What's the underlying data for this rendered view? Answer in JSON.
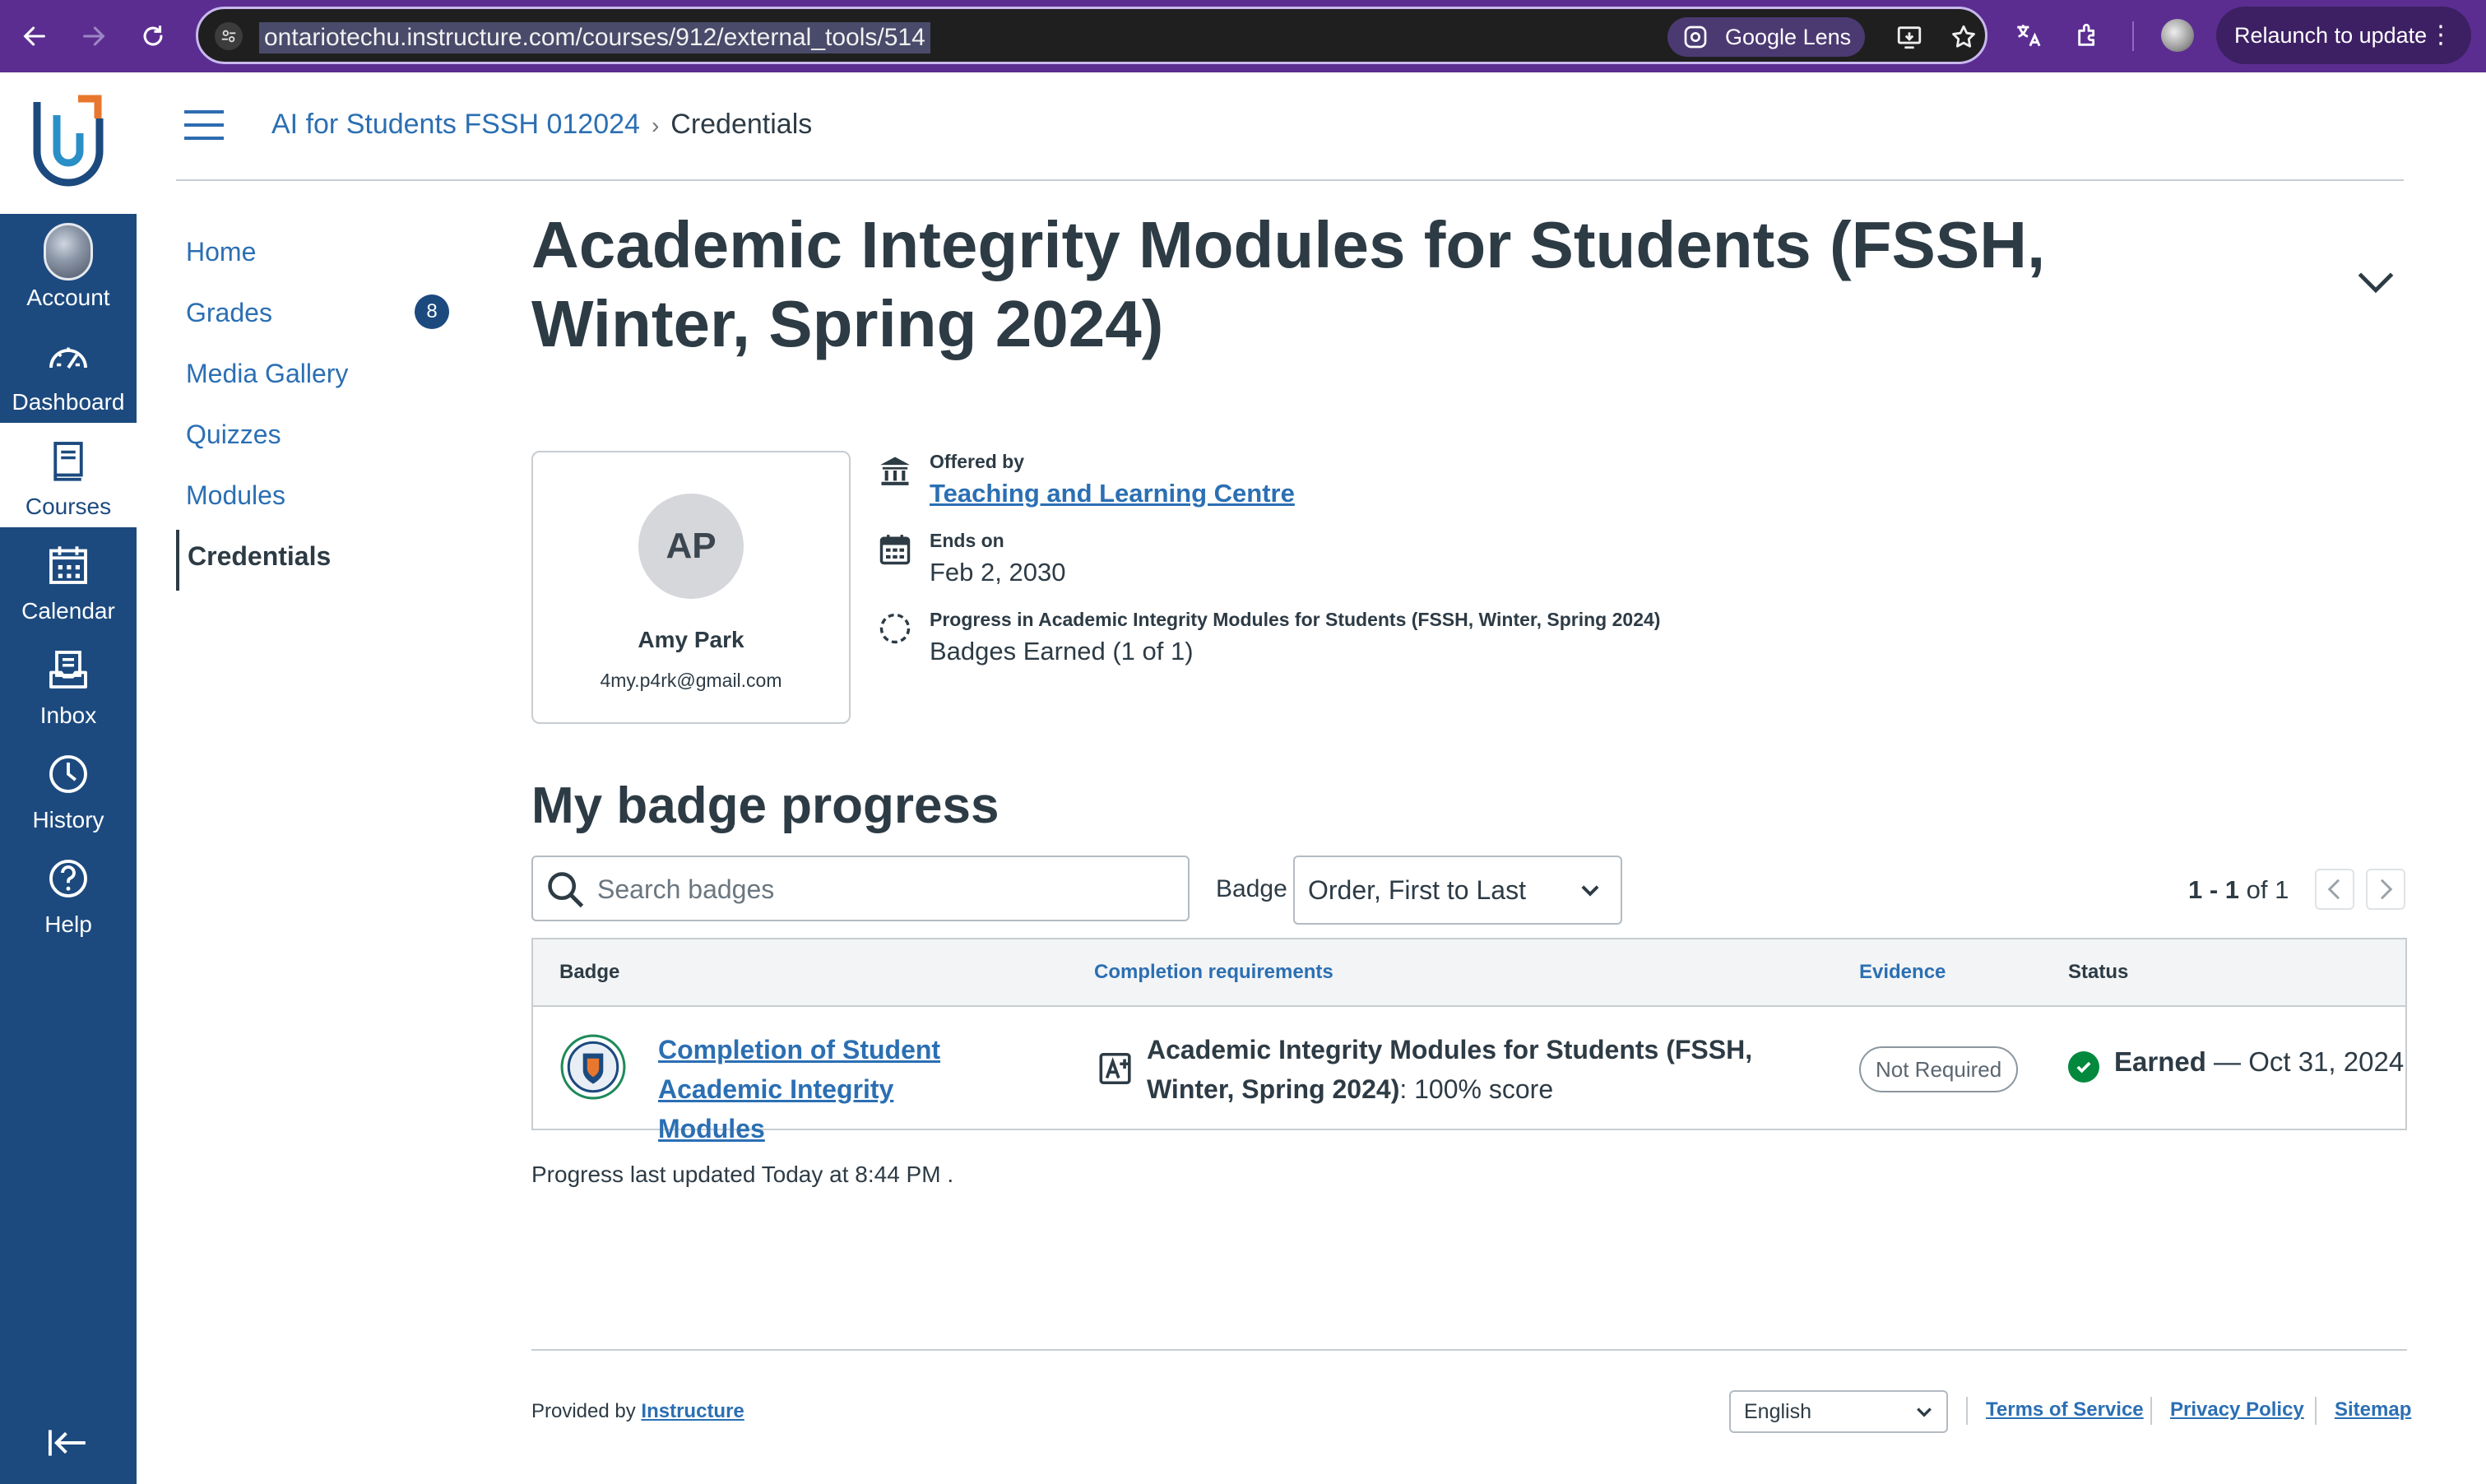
{
  "browser": {
    "url": "ontariotechu.instructure.com/courses/912/external_tools/514",
    "lens_label": "Google Lens",
    "relaunch_label": "Relaunch to update"
  },
  "global_nav": {
    "items": [
      {
        "label": "Account",
        "icon": "account-avatar-icon"
      },
      {
        "label": "Dashboard",
        "icon": "dashboard-icon"
      },
      {
        "label": "Courses",
        "icon": "courses-icon"
      },
      {
        "label": "Calendar",
        "icon": "calendar-icon"
      },
      {
        "label": "Inbox",
        "icon": "inbox-icon"
      },
      {
        "label": "History",
        "icon": "history-icon"
      },
      {
        "label": "Help",
        "icon": "help-icon"
      }
    ]
  },
  "breadcrumb": {
    "course": "AI for Students FSSH 012024",
    "current": "Credentials"
  },
  "course_nav": {
    "items": [
      {
        "label": "Home"
      },
      {
        "label": "Grades",
        "badge": "8"
      },
      {
        "label": "Media Gallery"
      },
      {
        "label": "Quizzes"
      },
      {
        "label": "Modules"
      },
      {
        "label": "Credentials",
        "active": true
      }
    ]
  },
  "pathway": {
    "title": "Academic Integrity Modules for Students (FSSH, Winter, Spring 2024)",
    "learner": {
      "initials": "AP",
      "name": "Amy Park",
      "email": "4my.p4rk@gmail.com"
    },
    "offered_by_label": "Offered by",
    "offered_by": "Teaching and Learning Centre",
    "ends_on_label": "Ends on",
    "ends_on": "Feb 2, 2030",
    "progress_label": "Progress in Academic Integrity Modules for Students (FSSH, Winter, Spring 2024)",
    "progress_value": "Badges Earned (1 of 1)"
  },
  "badge_progress": {
    "heading": "My badge progress",
    "search_placeholder": "Search badges",
    "sort_label": "Badge",
    "sort_value": "Order, First to Last",
    "pager": {
      "range": "1 - 1",
      "of_label": "of",
      "total": "1"
    },
    "columns": [
      "Badge",
      "Completion requirements",
      "Evidence",
      "Status"
    ],
    "rows": [
      {
        "badge_name": "Completion of Student Academic Integrity Modules",
        "requirement_course": "Academic Integrity Modules for Students (FSSH, Winter, Spring 2024)",
        "requirement_score": ": 100% score",
        "evidence": "Not Required",
        "status": "Earned",
        "status_date": " — Oct 31, 2024"
      }
    ],
    "updated_note": "Progress last updated Today at 8:44 PM ."
  },
  "footer": {
    "provided_by": "Provided by",
    "provider": "Instructure",
    "language": "English",
    "links": [
      "Terms of Service",
      "Privacy Policy",
      "Sitemap"
    ]
  },
  "colors": {
    "browser_chrome": "#5b2d91",
    "global_nav": "#1c4a7f",
    "link": "#2b6fb3",
    "earned_green": "#03893d"
  }
}
